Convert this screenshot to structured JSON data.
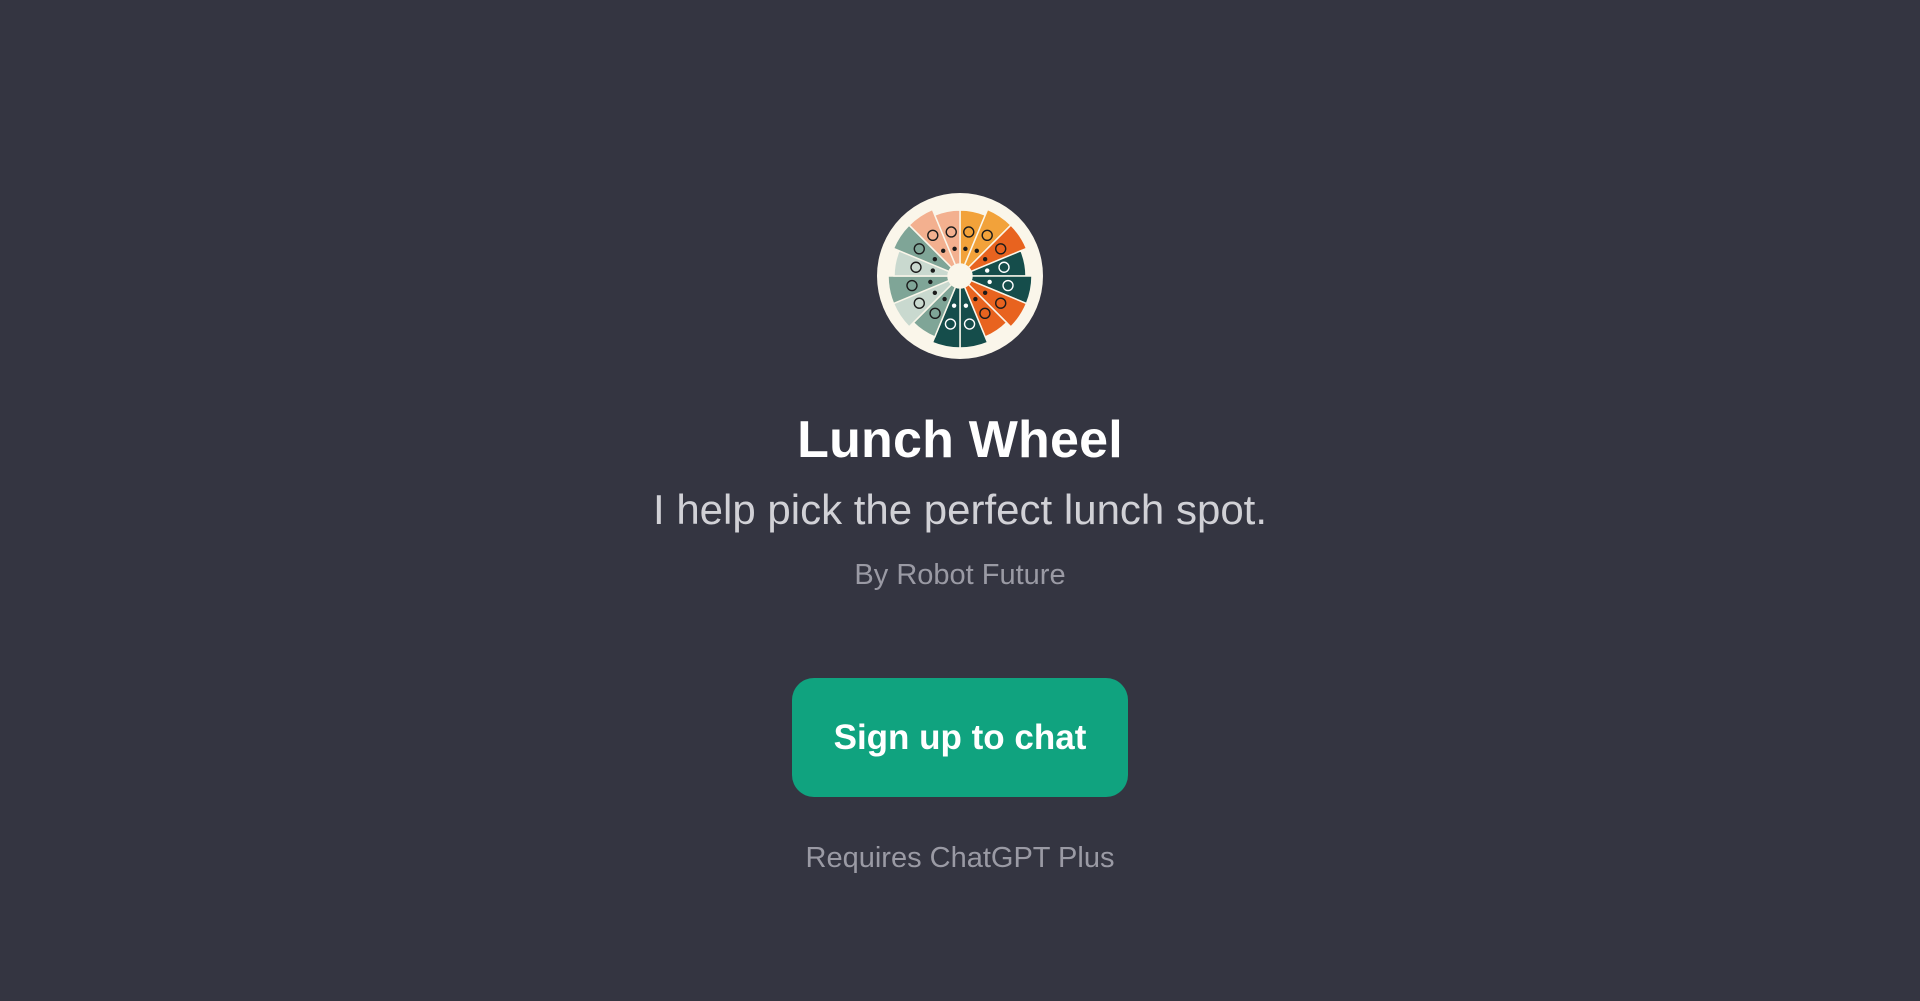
{
  "gpt": {
    "icon": "lunch-wheel-icon",
    "title": "Lunch Wheel",
    "description": "I help pick the perfect lunch spot.",
    "author": "By Robot Future"
  },
  "actions": {
    "signup_label": "Sign up to chat",
    "requirement_note": "Requires ChatGPT Plus"
  },
  "colors": {
    "background": "#343541",
    "button": "#10a37f",
    "wheel_orange": "#e8631f",
    "wheel_amber": "#f2a23a",
    "wheel_peach": "#f3b08f",
    "wheel_teal": "#154d4b",
    "wheel_sage": "#7fa597",
    "wheel_mint": "#c9d9cf",
    "wheel_cream": "#faf6ea"
  }
}
